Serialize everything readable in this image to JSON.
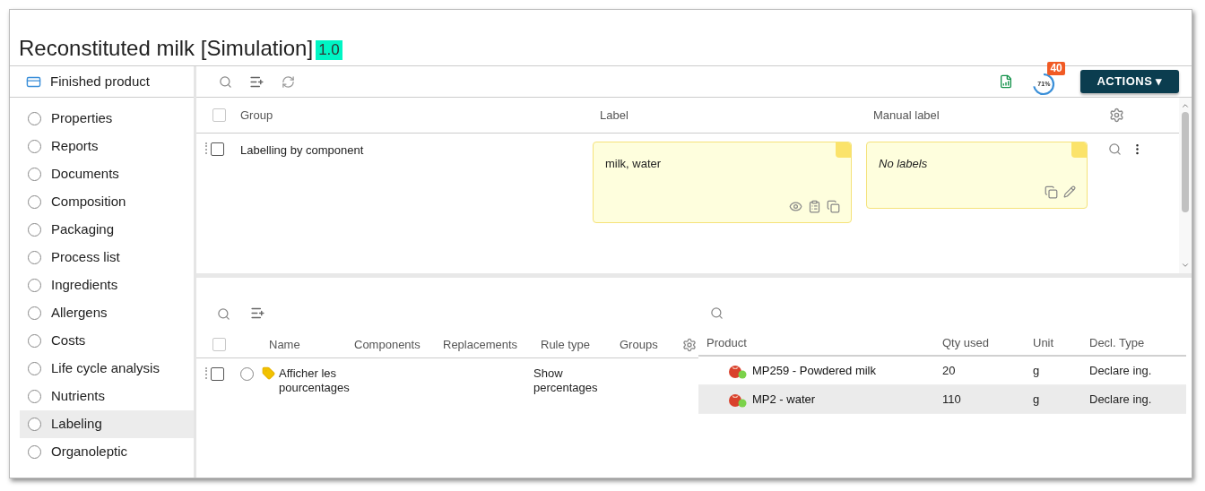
{
  "title": "Reconstituted milk [Simulation]",
  "version": "1.0",
  "sidebar": {
    "header": "Finished product",
    "items": [
      {
        "label": "Properties",
        "selected": false
      },
      {
        "label": "Reports",
        "selected": false
      },
      {
        "label": "Documents",
        "selected": false
      },
      {
        "label": "Composition",
        "selected": false
      },
      {
        "label": "Packaging",
        "selected": false
      },
      {
        "label": "Process list",
        "selected": false
      },
      {
        "label": "Ingredients",
        "selected": false
      },
      {
        "label": "Allergens",
        "selected": false
      },
      {
        "label": "Costs",
        "selected": false
      },
      {
        "label": "Life cycle analysis",
        "selected": false
      },
      {
        "label": "Nutrients",
        "selected": false
      },
      {
        "label": "Labeling",
        "selected": true
      },
      {
        "label": "Organoleptic",
        "selected": false
      }
    ]
  },
  "toolbar": {
    "progress": {
      "reading": "71%"
    },
    "badge": "40",
    "actions_button": "ACTIONS ▾"
  },
  "labeling_table": {
    "columns": [
      "Group",
      "Label",
      "Manual label"
    ],
    "header_checked": false,
    "rows": [
      {
        "checked": false,
        "group": "Labelling by component",
        "label": "milk, water",
        "manual_label": "No labels"
      }
    ]
  },
  "rules_table": {
    "columns": [
      "Name",
      "Components",
      "Replacements",
      "Rule type",
      "Groups"
    ],
    "header_checked": false,
    "rows": [
      {
        "checked": false,
        "selected": false,
        "name": "Afficher les pourcentages",
        "rule_type": "Show percentages"
      }
    ]
  },
  "components_table": {
    "columns": [
      "Product",
      "Qty used",
      "Unit",
      "Decl. Type"
    ],
    "rows": [
      {
        "product": "MP259 - Powdered milk",
        "qty": "20",
        "unit": "g",
        "decl_type": "Declare ing.",
        "selected": false
      },
      {
        "product": "MP2 - water",
        "qty": "110",
        "unit": "g",
        "decl_type": "Declare ing.",
        "selected": true
      }
    ]
  }
}
